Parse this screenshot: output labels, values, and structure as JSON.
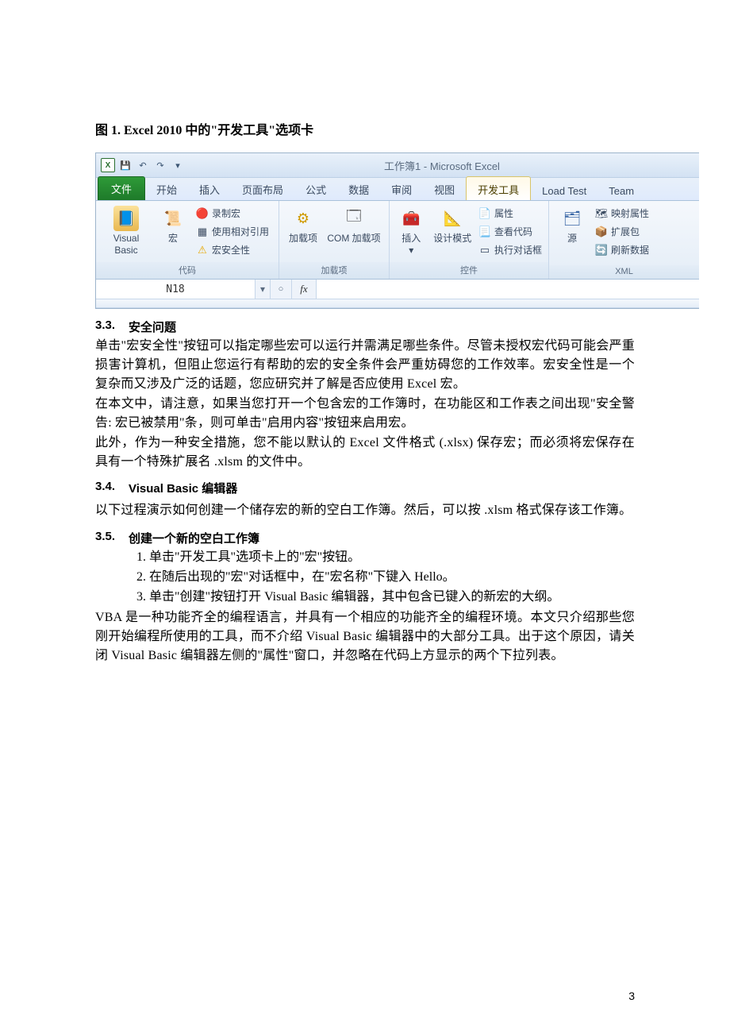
{
  "figure": {
    "caption": "图 1. Excel 2010 中的\"开发工具\"选项卡"
  },
  "excel": {
    "window_title": "工作簿1 - Microsoft Excel",
    "name_box": "N18",
    "fx_label": "fx",
    "tabs": {
      "file": "文件",
      "home": "开始",
      "insert": "插入",
      "layout": "页面布局",
      "formulas": "公式",
      "data": "数据",
      "review": "审阅",
      "view": "视图",
      "developer": "开发工具",
      "loadtest": "Load Test",
      "team": "Team"
    },
    "groups": {
      "code": {
        "label": "代码",
        "vb": "Visual Basic",
        "macros": "宏",
        "record": "录制宏",
        "relref": "使用相对引用",
        "security": "宏安全性"
      },
      "addins": {
        "label": "加载项",
        "addins": "加载项",
        "com": "COM 加载项"
      },
      "controls": {
        "label": "控件",
        "insert": "插入",
        "design": "设计模式",
        "props": "属性",
        "viewcode": "查看代码",
        "rundialog": "执行对话框"
      },
      "xml": {
        "label": "XML",
        "source": "源",
        "mapprops": "映射属性",
        "expansion": "扩展包",
        "refresh": "刷新数据"
      }
    }
  },
  "sections": {
    "s33": {
      "num": "3.3.",
      "title": "安全问题"
    },
    "p33a": "单击\"宏安全性\"按钮可以指定哪些宏可以运行并需满足哪些条件。尽管未授权宏代码可能会严重损害计算机，但阻止您运行有帮助的宏的安全条件会严重妨碍您的工作效率。宏安全性是一个复杂而又涉及广泛的话题，您应研究并了解是否应使用 Excel 宏。",
    "p33b": "在本文中，请注意，如果当您打开一个包含宏的工作簿时，在功能区和工作表之间出现\"安全警告: 宏已被禁用\"条，则可单击\"启用内容\"按钮来启用宏。",
    "p33c": "此外，作为一种安全措施，您不能以默认的 Excel 文件格式 (.xlsx) 保存宏；而必须将宏保存在具有一个特殊扩展名 .xlsm 的文件中。",
    "s34": {
      "num": "3.4.",
      "title": "Visual Basic 编辑器"
    },
    "p34a": "以下过程演示如何创建一个储存宏的新的空白工作簿。然后，可以按 .xlsm 格式保存该工作簿。",
    "s35": {
      "num": "3.5.",
      "title": "创建一个新的空白工作簿"
    },
    "steps": {
      "s1": "单击\"开发工具\"选项卡上的\"宏\"按钮。",
      "s2": "在随后出现的\"宏\"对话框中，在\"宏名称\"下键入  Hello。",
      "s3": "单击\"创建\"按钮打开 Visual Basic 编辑器，其中包含已键入的新宏的大纲。"
    },
    "p35b": "VBA 是一种功能齐全的编程语言，并具有一个相应的功能齐全的编程环境。本文只介绍那些您刚开始编程所使用的工具，而不介绍 Visual Basic 编辑器中的大部分工具。出于这个原因，请关闭 Visual Basic 编辑器左侧的\"属性\"窗口，并忽略在代码上方显示的两个下拉列表。"
  },
  "page_number": "3"
}
